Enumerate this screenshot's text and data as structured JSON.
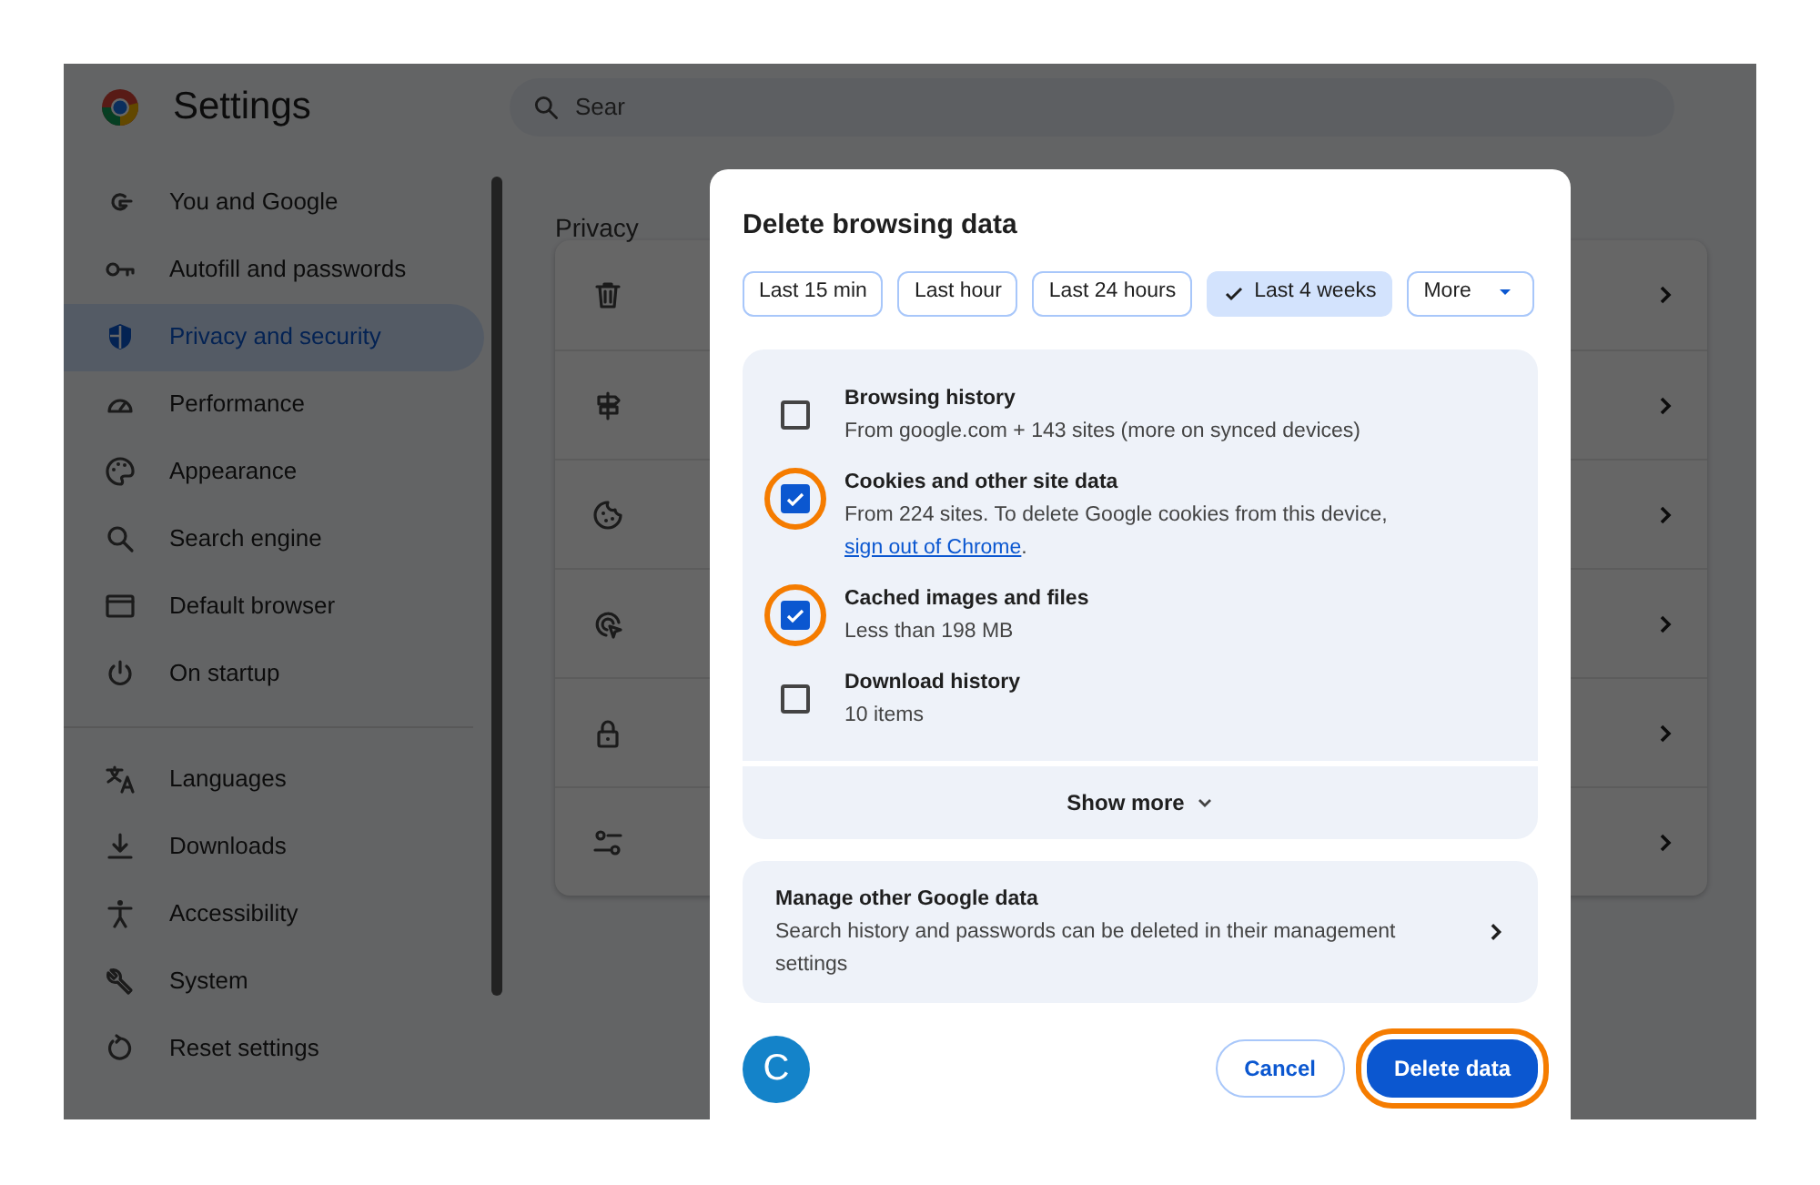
{
  "app": {
    "title": "Settings"
  },
  "search": {
    "placeholder": "Sear"
  },
  "sidebar": {
    "groups": [
      {
        "items": [
          {
            "label": "You and Google",
            "kind": "google",
            "selected": false
          },
          {
            "label": "Autofill and passwords",
            "kind": "key",
            "selected": false
          },
          {
            "label": "Privacy and security",
            "kind": "shield",
            "selected": true
          },
          {
            "label": "Performance",
            "kind": "gauge",
            "selected": false
          },
          {
            "label": "Appearance",
            "kind": "palette",
            "selected": false
          },
          {
            "label": "Search engine",
            "kind": "search",
            "selected": false
          },
          {
            "label": "Default browser",
            "kind": "browser",
            "selected": false
          },
          {
            "label": "On startup",
            "kind": "power",
            "selected": false
          }
        ]
      },
      {
        "items": [
          {
            "label": "Languages",
            "kind": "translate",
            "selected": false
          },
          {
            "label": "Downloads",
            "kind": "download",
            "selected": false
          },
          {
            "label": "Accessibility",
            "kind": "person",
            "selected": false
          },
          {
            "label": "System",
            "kind": "wrench",
            "selected": false
          },
          {
            "label": "Reset settings",
            "kind": "reset",
            "selected": false
          }
        ]
      }
    ]
  },
  "main": {
    "section_title": "Privacy",
    "rows": [
      {
        "kind": "trash"
      },
      {
        "kind": "signpost"
      },
      {
        "kind": "cookie"
      },
      {
        "kind": "target"
      },
      {
        "kind": "lock"
      },
      {
        "kind": "sliders"
      }
    ]
  },
  "dialog": {
    "title": "Delete browsing data",
    "ranges": [
      {
        "label": "Last 15 min",
        "kind": "chip",
        "selected": false
      },
      {
        "label": "Last hour",
        "kind": "chip",
        "selected": false
      },
      {
        "label": "Last 24 hours",
        "kind": "chip",
        "selected": false
      },
      {
        "label": "Last 4 weeks",
        "kind": "chip",
        "selected": true
      },
      {
        "label": "More",
        "kind": "dropdown",
        "selected": false
      }
    ],
    "options": [
      {
        "title": "Browsing history",
        "description": "From google.com + 143 sites (more on synced devices)",
        "checked": false,
        "highlighted": false
      },
      {
        "title": "Cookies and other site data",
        "description": "From 224 sites. To delete Google cookies from this device, ",
        "link": "sign out of Chrome",
        "description_end": ".",
        "checked": true,
        "highlighted": true
      },
      {
        "title": "Cached images and files",
        "description": "Less than 198 MB",
        "checked": true,
        "highlighted": true
      },
      {
        "title": "Download history",
        "description": "10 items",
        "checked": false,
        "highlighted": false
      }
    ],
    "show_more": "Show more",
    "manage": {
      "title": "Manage other Google data",
      "description": "Search history and passwords can be deleted in their management settings"
    },
    "avatar": "C",
    "cancel": {
      "label": "Cancel"
    },
    "delete": {
      "label": "Delete data",
      "highlighted": true
    }
  }
}
